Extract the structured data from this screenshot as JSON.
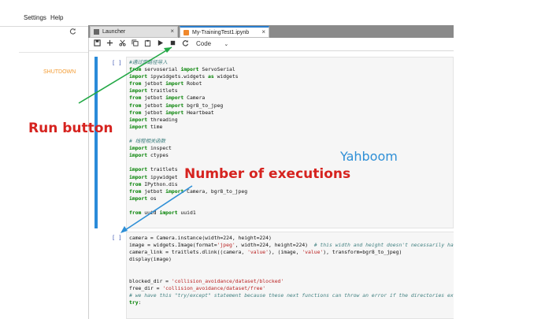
{
  "menu": {
    "items": [
      "Settings",
      "Help"
    ]
  },
  "sidebar": {
    "refresh_icon": "refresh-icon",
    "shutdown_label": "SHUTDOWN"
  },
  "tabs": [
    {
      "label": "Launcher",
      "icon": "launcher-icon",
      "close": "×"
    },
    {
      "label": "My-TrainingTest1.ipynb",
      "icon": "notebook-icon",
      "close": "×"
    }
  ],
  "toolbar": {
    "icons": [
      "save-icon",
      "add-cell-icon",
      "cut-icon",
      "copy-icon",
      "paste-icon",
      "run-icon",
      "stop-icon",
      "restart-icon"
    ],
    "cell_type": "Code"
  },
  "cells": [
    {
      "prompt": "[ ]",
      "lines": [
        [
          [
            "cm",
            "#通过库路径导入"
          ]
        ],
        [
          [
            "kw",
            "from"
          ],
          [
            "",
            " servoserial "
          ],
          [
            "kw",
            "import"
          ],
          [
            "",
            " ServoSerial"
          ]
        ],
        [
          [
            "kw",
            "import"
          ],
          [
            "",
            " ipywidgets.widgets "
          ],
          [
            "kw",
            "as"
          ],
          [
            "",
            " widgets"
          ]
        ],
        [
          [
            "kw",
            "from"
          ],
          [
            "",
            " jetbot "
          ],
          [
            "kw",
            "import"
          ],
          [
            "",
            " Robot"
          ]
        ],
        [
          [
            "kw",
            "import"
          ],
          [
            "",
            " traitlets"
          ]
        ],
        [
          [
            "kw",
            "from"
          ],
          [
            "",
            " jetbot "
          ],
          [
            "kw",
            "import"
          ],
          [
            "",
            " Camera"
          ]
        ],
        [
          [
            "kw",
            "from"
          ],
          [
            "",
            " jetbot "
          ],
          [
            "kw",
            "import"
          ],
          [
            "",
            " bgr8_to_jpeg"
          ]
        ],
        [
          [
            "kw",
            "from"
          ],
          [
            "",
            " jetbot "
          ],
          [
            "kw",
            "import"
          ],
          [
            "",
            " Heartbeat"
          ]
        ],
        [
          [
            "kw",
            "import"
          ],
          [
            "",
            " threading"
          ]
        ],
        [
          [
            "kw",
            "import"
          ],
          [
            "",
            " time"
          ]
        ],
        [
          [
            "",
            ""
          ]
        ],
        [
          [
            "cm",
            "# 线程相关函数"
          ]
        ],
        [
          [
            "kw",
            "import"
          ],
          [
            "",
            " inspect"
          ]
        ],
        [
          [
            "kw",
            "import"
          ],
          [
            "",
            " ctypes"
          ]
        ],
        [
          [
            "",
            ""
          ]
        ],
        [
          [
            "kw",
            "import"
          ],
          [
            "",
            " traitlets"
          ]
        ],
        [
          [
            "kw",
            "import"
          ],
          [
            "",
            " ipywidget"
          ]
        ],
        [
          [
            "kw",
            "from"
          ],
          [
            "",
            " IPython.dis"
          ]
        ],
        [
          [
            "kw",
            "from"
          ],
          [
            "",
            " jetbot "
          ],
          [
            "kw",
            "import"
          ],
          [
            "",
            " Camera, bgr8_to_jpeg"
          ]
        ],
        [
          [
            "kw",
            "import"
          ],
          [
            "",
            " os"
          ]
        ],
        [
          [
            "",
            ""
          ]
        ],
        [
          [
            "kw",
            "from"
          ],
          [
            "",
            " uuid "
          ],
          [
            "kw",
            "import"
          ],
          [
            "",
            " uuid1"
          ]
        ]
      ]
    },
    {
      "prompt": "[ ]",
      "lines": [
        [
          [
            "",
            "camera = Camera.instance(width=224, height=224)"
          ]
        ],
        [
          [
            "",
            "image = widgets.Image(format="
          ],
          [
            "st",
            "'jpeg'"
          ],
          [
            "",
            ", width=224, height=224)  "
          ],
          [
            "cm",
            "# this width and height doesn't necessarily ha"
          ]
        ],
        [
          [
            "",
            "camera_link = traitlets.dlink((camera, "
          ],
          [
            "st",
            "'value'"
          ],
          [
            "",
            "), (image, "
          ],
          [
            "st",
            "'value'"
          ],
          [
            "",
            "), transform=bgr8_to_jpeg)"
          ]
        ],
        [
          [
            "",
            "display(image)"
          ]
        ],
        [
          [
            "",
            ""
          ]
        ],
        [
          [
            "",
            ""
          ]
        ],
        [
          [
            "",
            "blocked_dir = "
          ],
          [
            "st",
            "'collision_avoidance/dataset/blocked'"
          ]
        ],
        [
          [
            "",
            "free_dir = "
          ],
          [
            "st",
            "'collision_avoidance/dataset/free'"
          ]
        ],
        [
          [
            "cm",
            "# we have this \"try/except\" statement because these next functions can throw an error if the directories ex"
          ]
        ],
        [
          [
            "kw",
            "try"
          ],
          [
            "",
            ":"
          ]
        ]
      ]
    }
  ],
  "annotations": {
    "run_button": "Run button",
    "number_of_executions": "Number of executions",
    "watermark": "Yahboom"
  },
  "colors": {
    "accent": "#2a8bd9",
    "annotation": "#d6231f",
    "arrow": "#22a845",
    "watermark": "#2e8fd6",
    "shutdown": "#f39c34"
  }
}
